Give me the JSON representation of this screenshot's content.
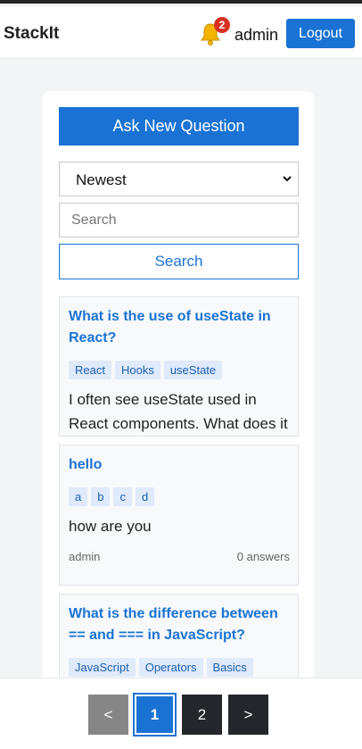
{
  "header": {
    "brand": "StackIt",
    "notification_count": "2",
    "username": "admin",
    "logout_label": "Logout"
  },
  "main": {
    "ask_label": "Ask New Question",
    "sort_value": "Newest",
    "search_placeholder": "Search",
    "search_label": "Search"
  },
  "questions": [
    {
      "title": "What is the use of useState in React?",
      "tags": [
        "React",
        "Hooks",
        "useState"
      ],
      "body": "I often see useState used in React components. What does it do and how do I use it?"
    },
    {
      "title": "hello",
      "tags": [
        "a",
        "b",
        "c",
        "d"
      ],
      "body": "how are you",
      "author": "admin",
      "answers": "0 answers"
    },
    {
      "title": "What is the difference between == and === in JavaScript?",
      "tags": [
        "JavaScript",
        "Operators",
        "Basics"
      ]
    }
  ],
  "pagination": {
    "prev": "<",
    "pages": [
      "1",
      "2"
    ],
    "next": ">"
  },
  "colors": {
    "accent": "#1a73d4",
    "badge": "#d93025",
    "bell": "#f5b400"
  }
}
